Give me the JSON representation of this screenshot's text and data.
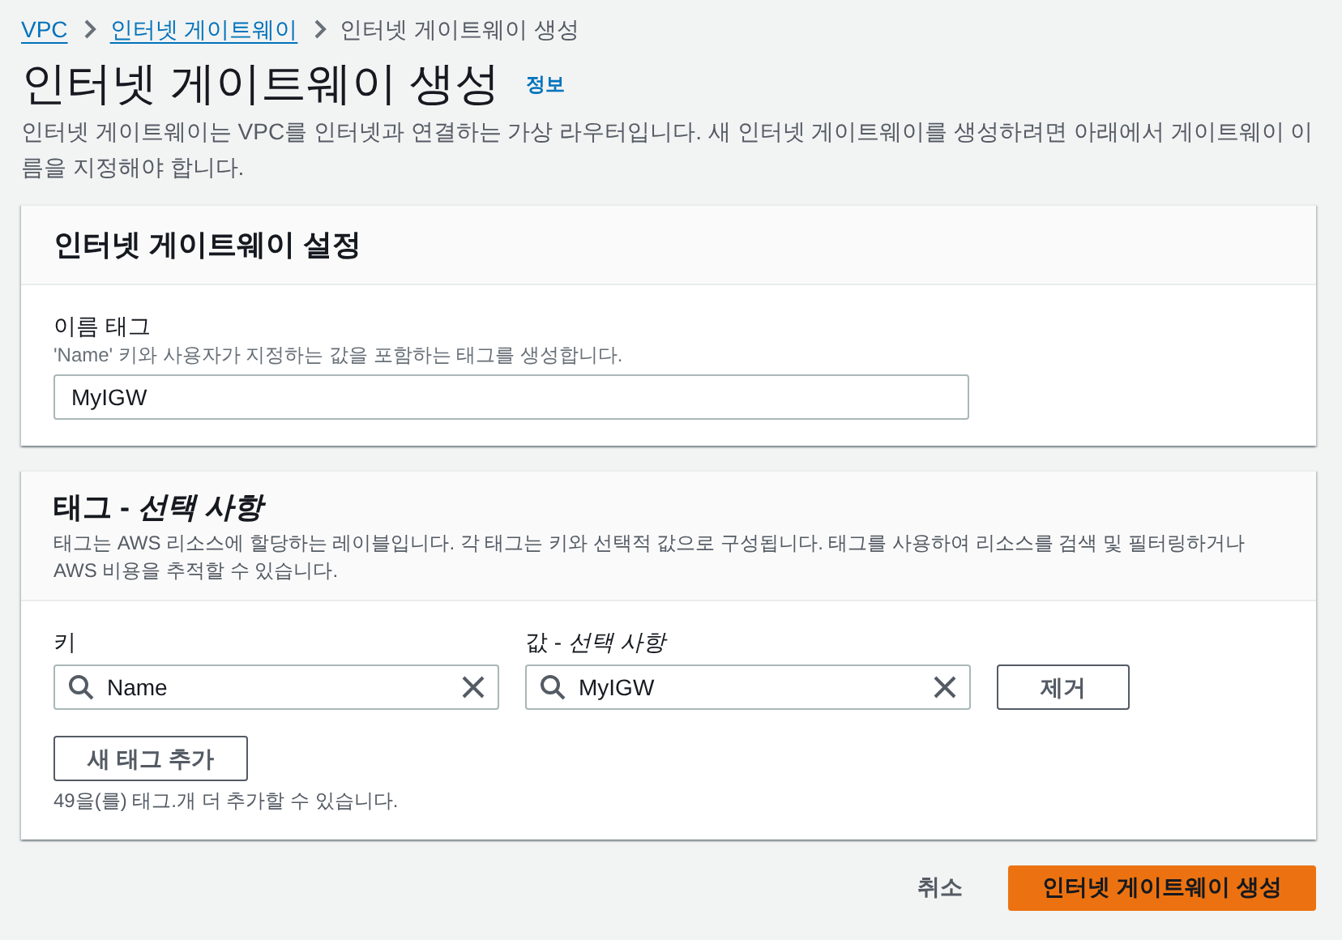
{
  "breadcrumb": [
    {
      "label": "VPC",
      "link": true
    },
    {
      "label": "인터넷 게이트웨이",
      "link": true
    },
    {
      "label": "인터넷 게이트웨이 생성",
      "link": false
    }
  ],
  "page": {
    "title": "인터넷 게이트웨이 생성",
    "info_link": "정보",
    "description": "인터넷 게이트웨이는 VPC를 인터넷과 연결하는 가상 라우터입니다. 새 인터넷 게이트웨이를 생성하려면 아래에서 게이트웨이 이름을 지정해야 합니다."
  },
  "settings": {
    "title": "인터넷 게이트웨이 설정",
    "name_tag": {
      "label": "이름 태그",
      "hint": "'Name' 키와 사용자가 지정하는 값을 포함하는 태그를 생성합니다.",
      "value": "MyIGW"
    }
  },
  "tags": {
    "title": "태그 - *선택 사항*",
    "description": "태그는 AWS 리소스에 할당하는 레이블입니다. 각 태그는 키와 선택적 값으로 구성됩니다. 태그를 사용하여 리소스를 검색 및 필터링하거나 AWS 비용을 추적할 수 있습니다.",
    "key_label": "키",
    "value_label": "값 - *선택 사항*",
    "rows": [
      {
        "key": "Name",
        "value": "MyIGW",
        "remove_button": "제거"
      }
    ],
    "add_button": "새 태그 추가",
    "remaining": "49을(를) 태그.개 더 추가할 수 있습니다."
  },
  "footer": {
    "cancel": "취소",
    "submit": "인터넷 게이트웨이 생성"
  }
}
